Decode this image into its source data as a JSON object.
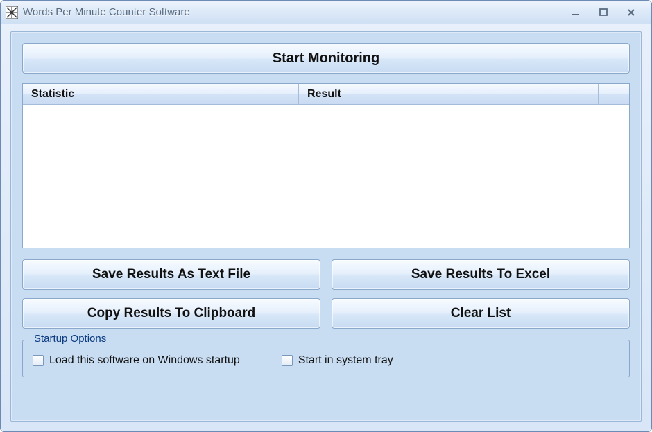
{
  "window": {
    "title": "Words Per Minute Counter Software"
  },
  "buttons": {
    "start": "Start Monitoring",
    "save_text": "Save Results As Text File",
    "save_excel": "Save Results To Excel",
    "copy_clip": "Copy Results To Clipboard",
    "clear_list": "Clear List"
  },
  "columns": {
    "statistic": "Statistic",
    "result": "Result"
  },
  "group": {
    "title": "Startup Options",
    "load_startup": "Load this software on Windows startup",
    "start_tray": "Start in system tray"
  }
}
